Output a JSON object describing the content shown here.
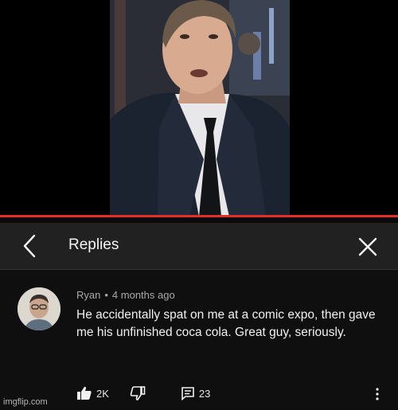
{
  "video": {
    "progress_fraction": 1.0
  },
  "header": {
    "title": "Replies",
    "back_icon": "chevron-left-icon",
    "close_icon": "close-icon"
  },
  "comment": {
    "author": "Ryan",
    "separator": "•",
    "age": "4 months ago",
    "text": "He accidentally spat on me at a comic expo, then gave me his unfinished coca cola. Great guy, seriously.",
    "likes": "2K",
    "replies": "23"
  },
  "watermark": "imgflip.com",
  "colors": {
    "accent": "#e52d27",
    "header_bg": "#212121",
    "body_bg": "#0f0f0f"
  }
}
